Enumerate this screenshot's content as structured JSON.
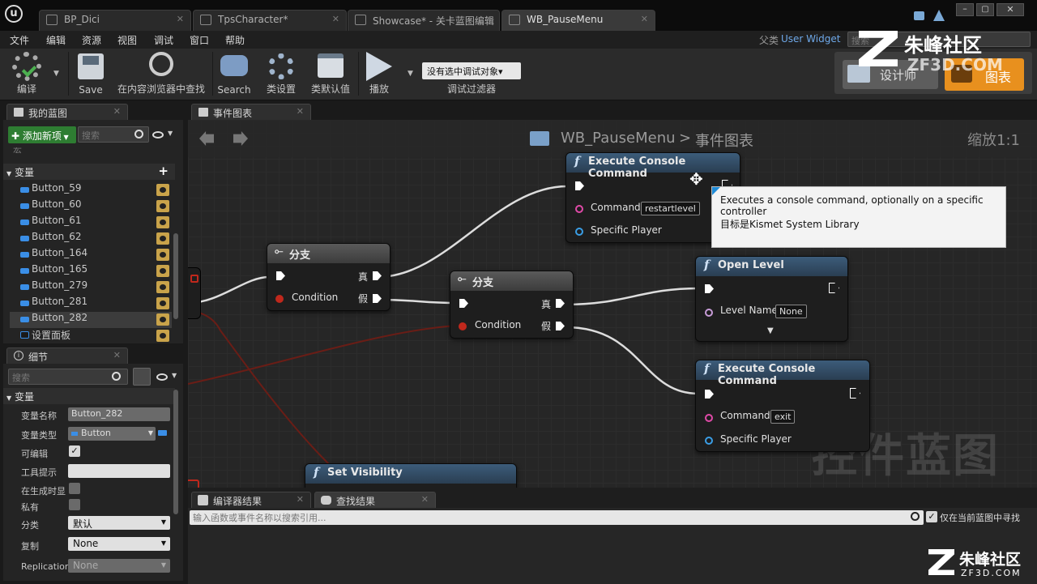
{
  "tabs": [
    "BP_Dici",
    "TpsCharacter*",
    "Showcase* - 关卡蓝图编辑",
    "WB_PauseMenu"
  ],
  "menu": [
    "文件",
    "编辑",
    "资源",
    "视图",
    "调试",
    "窗口",
    "帮助"
  ],
  "parent_class": {
    "label": "父类",
    "value": "User Widget"
  },
  "top_search_placeholder": "搜索",
  "toolbar": {
    "compile": "编译",
    "save": "Save",
    "find_in_cb": "在内容浏览器中查找",
    "search": "Search",
    "class_settings": "类设置",
    "class_defaults": "类默认值",
    "play": "播放",
    "debug_target": "没有选中调试对象▾",
    "debug_filter": "调试过滤器"
  },
  "mode_tabs": {
    "designer": "设计师",
    "graph": "图表"
  },
  "my_blueprint": {
    "tab": "我的蓝图",
    "add_new": "添加新项",
    "search_placeholder": "搜索",
    "truncated_above": "宏",
    "variables_header": "变量",
    "variables": [
      "Button_59",
      "Button_60",
      "Button_61",
      "Button_62",
      "Button_164",
      "Button_165",
      "Button_279",
      "Button_281",
      "Button_282",
      "设置面板"
    ],
    "selected": "Button_282"
  },
  "details": {
    "tab": "细节",
    "search_placeholder": "搜索",
    "section": "变量",
    "rows": {
      "name_label": "变量名称",
      "name_value": "Button_282",
      "type_label": "变量类型",
      "type_value": "Button",
      "editable_label": "可编辑",
      "tooltip_label": "工具提示",
      "expose_label": "在生成时显",
      "private_label": "私有",
      "category_label": "分类",
      "category_value": "默认",
      "replication_label": "复制",
      "replication_value": "None",
      "repcond_label": "Replication",
      "repcond_value": "None"
    }
  },
  "graph": {
    "tab": "事件图表",
    "breadcrumb_root": "WB_PauseMenu",
    "breadcrumb_sep": ">",
    "breadcrumb_leaf": "事件图表",
    "zoom": "缩放1:1",
    "watermark": "控件蓝图",
    "nodes": {
      "exec_top": {
        "title": "Execute Console Command",
        "pin_command": "Command",
        "command_value": "restartlevel",
        "pin_player": "Specific Player"
      },
      "branch1": {
        "title": "分支",
        "pin_cond": "Condition",
        "true": "真",
        "false": "假"
      },
      "branch2": {
        "title": "分支",
        "pin_cond": "Condition",
        "true": "真",
        "false": "假"
      },
      "open_level": {
        "title": "Open Level",
        "pin_level": "Level Name",
        "level_value": "None"
      },
      "exec_bottom": {
        "title": "Execute Console Command",
        "pin_command": "Command",
        "command_value": "exit",
        "pin_player": "Specific Player"
      },
      "set_visibility": {
        "title": "Set Visibility"
      }
    },
    "tooltip": {
      "line1": "Executes a console command, optionally on a specific controller",
      "line2": "目标是Kismet System Library"
    }
  },
  "bottom": {
    "tab_compiler": "编译器结果",
    "tab_find": "查找结果",
    "find_placeholder": "输入函数或事件名称以搜索引用...",
    "only_current": "仅在当前蓝图中寻找"
  },
  "watermark_brand": {
    "cn": "朱峰社区",
    "url": "ZF3D.COM"
  },
  "colors": {
    "exec_pin": "#ffffff",
    "bool_pin": "#c0281c",
    "string_pin": "#e04aa8",
    "object_pin": "#3a9ee6",
    "variable_pill": "#3a8ee6",
    "accent_orange": "#e8901e"
  }
}
